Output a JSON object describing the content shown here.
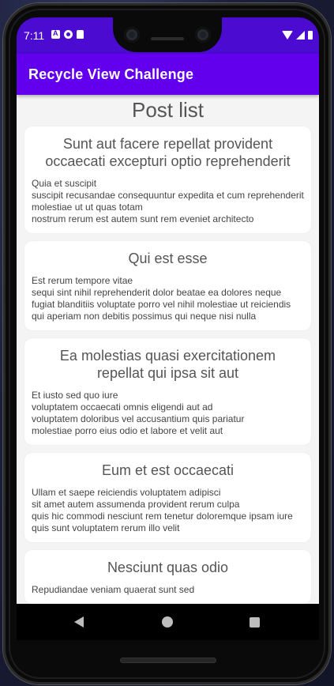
{
  "status_bar": {
    "time": "7:11"
  },
  "app_bar": {
    "title": "Recycle View Challenge"
  },
  "page": {
    "title": "Post list"
  },
  "posts": [
    {
      "title": "Sunt aut facere repellat provident occaecati excepturi optio reprehenderit",
      "body": "Quia et suscipit\nsuscipit recusandae consequuntur expedita et cum reprehenderit molestiae ut ut quas totam\nnostrum rerum est autem sunt rem eveniet architecto"
    },
    {
      "title": "Qui est esse",
      "body": "Est rerum tempore vitae\nsequi sint nihil reprehenderit dolor beatae ea dolores neque fugiat blanditiis voluptate porro vel nihil molestiae ut reiciendis\nqui aperiam non debitis possimus qui neque nisi nulla"
    },
    {
      "title": "Ea molestias quasi exercitationem repellat qui ipsa sit aut",
      "body": "Et iusto sed quo iure\nvoluptatem occaecati omnis eligendi aut ad\nvoluptatem doloribus vel accusantium quis pariatur\nmolestiae porro eius odio et labore et velit aut"
    },
    {
      "title": "Eum et est occaecati",
      "body": "Ullam et saepe reiciendis voluptatem adipisci\nsit amet autem assumenda provident rerum culpa\nquis hic commodi nesciunt rem tenetur doloremque ipsam iure\nquis sunt voluptatem rerum illo velit"
    },
    {
      "title": "Nesciunt quas odio",
      "body": "Repudiandae veniam quaerat sunt sed"
    }
  ],
  "colors": {
    "status_bar": "#4b0bd1",
    "app_bar": "#6200ee",
    "background": "#f4f4f4",
    "card": "#ffffff"
  }
}
